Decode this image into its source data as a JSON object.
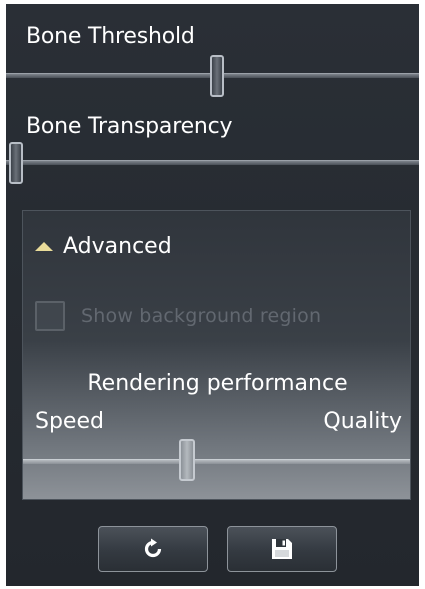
{
  "bone_threshold": {
    "label": "Bone Threshold",
    "value_fraction": 0.5
  },
  "bone_transparency": {
    "label": "Bone Transparency",
    "value_fraction": 0.0
  },
  "advanced": {
    "title": "Advanced",
    "expanded": true,
    "expander_icon": "triangle-up-icon",
    "checkbox": {
      "label": "Show background region",
      "checked": false,
      "enabled": false
    },
    "rendering_performance": {
      "title": "Rendering performance",
      "min_label": "Speed",
      "max_label": "Quality",
      "value_fraction": 0.42
    }
  },
  "buttons": {
    "reset_icon": "reset-icon",
    "save_icon": "save-icon"
  },
  "colors": {
    "panel_background": "#272c32",
    "expander_accent": "#e9dc9a",
    "text": "#ffffff",
    "disabled_text": "#626870"
  }
}
